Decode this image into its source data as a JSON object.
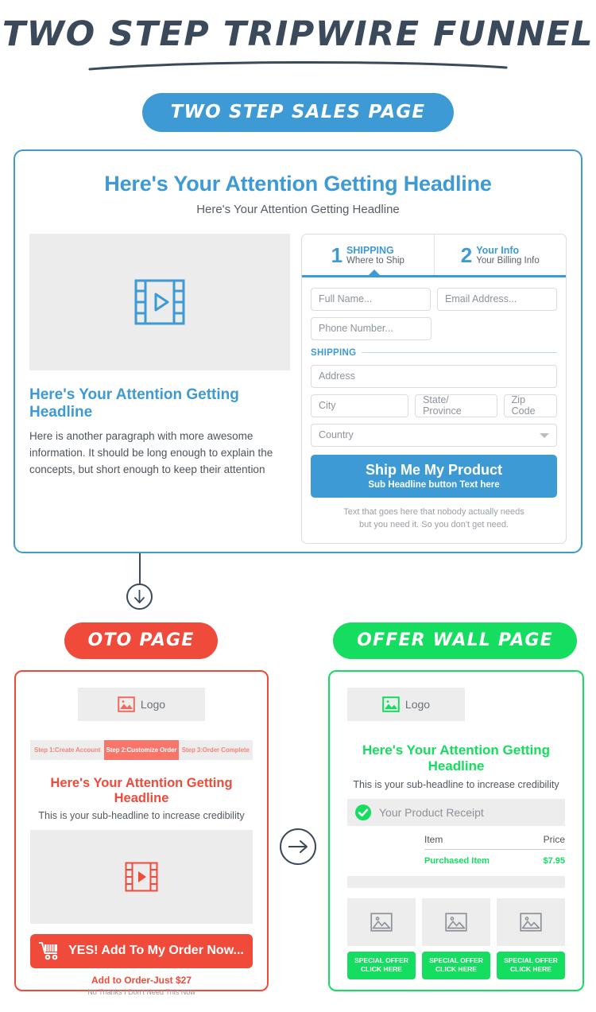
{
  "header": {
    "title": "TWO STEP TRIPWIRE FUNNEL",
    "section_badge": "TWO STEP SALES PAGE"
  },
  "colors": {
    "blue": "#3d9ad4",
    "red": "#ef4a3a",
    "green": "#14dd5f",
    "dark": "#3b4a5a",
    "gray_box": "#ececec"
  },
  "sales_page": {
    "headline": "Here's Your Attention Getting Headline",
    "subheadline": "Here's Your Attention Getting Headline",
    "video_icon": "film-play-icon",
    "left_headline": "Here's Your Attention Getting Headline",
    "left_paragraph": "Here is another paragraph with more awesome information. It should be long enough to explain the concepts, but short enough to keep their attention",
    "form": {
      "tabs": [
        {
          "number": "1",
          "title": "SHIPPING",
          "subtitle": "Where to Ship",
          "active": true
        },
        {
          "number": "2",
          "title": "Your Info",
          "subtitle": "Your Billing Info",
          "active": false
        }
      ],
      "fields": {
        "full_name": "Full Name...",
        "email": "Email Address...",
        "phone": "Phone Number...",
        "address": "Address",
        "city": "City",
        "state": "State/ Province",
        "zip": "Zip Code",
        "country": "Country"
      },
      "section_label": "SHIPPING",
      "button_title": "Ship Me My Product",
      "button_subtitle": "Sub Headline button Text here",
      "fine_print_line1": "Text that goes here that nobody actually needs",
      "fine_print_line2": "but you need it. So you don't get need."
    }
  },
  "connector": {
    "down_arrow_icon": "arrow-down-icon",
    "right_arrow_icon": "arrow-right-icon"
  },
  "oto_page": {
    "badge": "OTO PAGE",
    "logo_label": "Logo",
    "logo_icon": "image-placeholder-icon",
    "steps": [
      {
        "label": "Step 1:Create Account",
        "active": false
      },
      {
        "label": "Step 2:Customize Order",
        "active": true
      },
      {
        "label": "Step 3:Order Complete",
        "active": false
      }
    ],
    "headline": "Here's Your Attention Getting Headline",
    "subheadline": "This is your sub-headline to increase credibility",
    "video_icon": "film-play-icon",
    "cta_icon": "shopping-cart-icon",
    "cta_label": "YES! Add To My Order Now...",
    "price_note": "Add to Order-Just $27",
    "decline_note": "No Thanks I Don't Need This Now"
  },
  "offer_wall_page": {
    "badge": "OFFER WALL PAGE",
    "logo_label": "Logo",
    "logo_icon": "image-placeholder-icon",
    "headline": "Here's Your Attention Getting Headline",
    "subheadline": "This is your sub-headline to increase credibility",
    "receipt_icon": "check-circle-icon",
    "receipt_label": "Your Product Receipt",
    "table": {
      "headers": [
        "Item",
        "Price"
      ],
      "rows": [
        [
          "Purchased Item",
          "$7.95"
        ]
      ]
    },
    "tiles": [
      {
        "image_icon": "image-placeholder-icon",
        "line1": "SPECIAL OFFER",
        "line2": "CLICK HERE"
      },
      {
        "image_icon": "image-placeholder-icon",
        "line1": "SPECIAL OFFER",
        "line2": "CLICK HERE"
      },
      {
        "image_icon": "image-placeholder-icon",
        "line1": "SPECIAL OFFER",
        "line2": "CLICK HERE"
      }
    ]
  }
}
